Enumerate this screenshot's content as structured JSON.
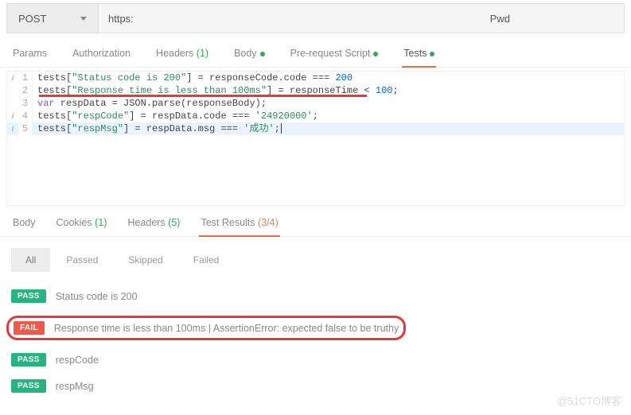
{
  "request": {
    "method": "POST",
    "url": "https:                                                                                                                            Pwd"
  },
  "tabs": {
    "params": "Params",
    "auth": "Authorization",
    "headers": "Headers",
    "headers_count": "(1)",
    "body": "Body",
    "prereq": "Pre-request Script",
    "tests": "Tests"
  },
  "code": {
    "l1": {
      "i": "i",
      "n": "1",
      "p1": "tests[",
      "s1": "\"Status code is 200\"",
      "p2": "] = responseCode.code === ",
      "n1": "200"
    },
    "l2": {
      "i": "",
      "n": "2",
      "p1": "tests[",
      "s1": "\"Response time is less than 100ms\"",
      "p2": "] = responseTime < ",
      "n1": "100",
      "p3": ";"
    },
    "l3": {
      "i": "",
      "n": "3",
      "kw": "var",
      "p1": " respData = JSON.parse(responseBody);"
    },
    "l4": {
      "i": "i",
      "n": "4",
      "p1": "tests[",
      "s1": "\"respCode\"",
      "p2": "] = respData.code === ",
      "s2": "'24920000'",
      "p3": ";"
    },
    "l5": {
      "i": "i",
      "n": "5",
      "p1": "tests[",
      "s1": "\"respMsg\"",
      "p2": "] = respData.msg === ",
      "s2": "'成功'",
      "p3": ";"
    }
  },
  "results_tabs": {
    "body": "Body",
    "cookies": "Cookies",
    "cookies_count": "(1)",
    "headers": "Headers",
    "headers_count": "(5)",
    "testresults": "Test Results",
    "testresults_count": "(3/4)"
  },
  "filters": {
    "all": "All",
    "passed": "Passed",
    "skipped": "Skipped",
    "failed": "Failed"
  },
  "results": {
    "r1": {
      "status": "PASS",
      "text": "Status code is 200"
    },
    "r2": {
      "status": "FAIL",
      "text": "Response time is less than 100ms | AssertionError: expected false to be truthy"
    },
    "r3": {
      "status": "PASS",
      "text": "respCode"
    },
    "r4": {
      "status": "PASS",
      "text": "respMsg"
    }
  },
  "watermark": "@51CTO博客"
}
